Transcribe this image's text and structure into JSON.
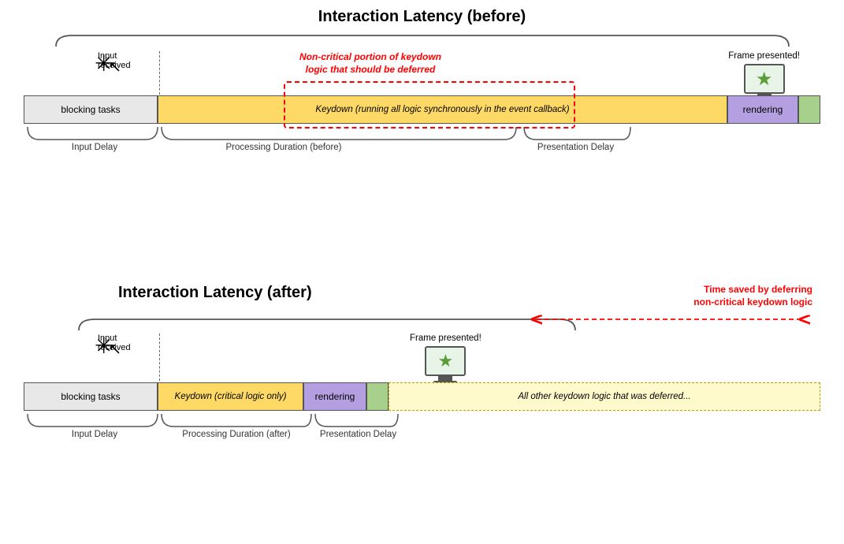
{
  "top": {
    "title": "Interaction Latency (before)",
    "input_received": "Input received",
    "frame_presented": "Frame presented!",
    "blocking_tasks": "blocking tasks",
    "keydown_label": "Keydown (running all logic synchronously in the event callback)",
    "rendering": "rendering",
    "non_critical_annotation": "Non-critical portion of keydown\nlogic that should be deferred",
    "input_delay_label": "Input Delay",
    "processing_duration_label": "Processing Duration (before)",
    "presentation_delay_label": "Presentation Delay"
  },
  "bottom": {
    "title": "Interaction Latency (after)",
    "input_received": "Input received",
    "frame_presented": "Frame presented!",
    "blocking_tasks": "blocking tasks",
    "keydown_label": "Keydown (critical logic only)",
    "rendering": "rendering",
    "deferred_label": "All other keydown logic that was deferred...",
    "time_saved_annotation": "Time saved by deferring\nnon-critical keydown logic",
    "input_delay_label": "Input Delay",
    "processing_duration_label": "Processing Duration (after)",
    "presentation_delay_label": "Presentation Delay"
  },
  "star": "★"
}
